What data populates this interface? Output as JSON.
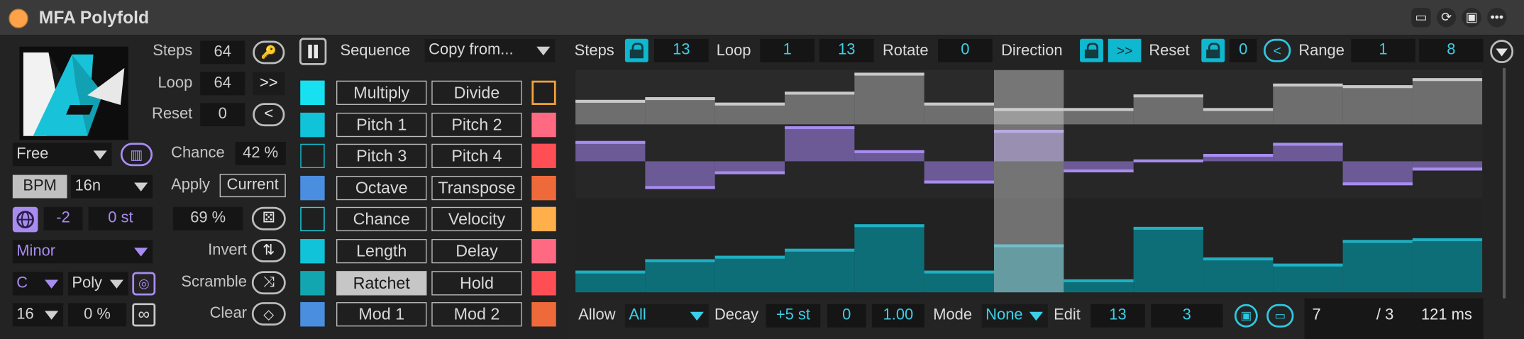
{
  "window": {
    "title": "MFA Polyfold"
  },
  "left": {
    "steps_label": "Steps",
    "steps_value": "64",
    "loop_label": "Loop",
    "loop_value": "64",
    "loop_btn": ">>",
    "reset_label": "Reset",
    "reset_value": "0",
    "reset_btn": "<",
    "mode_select": "Free",
    "bpm_label": "BPM",
    "rate_select": "16n",
    "transpose_value": "-2",
    "st_value": "0 st",
    "scale_select": "Minor",
    "root_select": "C",
    "poly_select": "Poly",
    "length_select": "16",
    "percent_value": "0 %",
    "chance_label": "Chance",
    "chance_value": "42 %",
    "apply_label": "Apply",
    "apply_value": "Current",
    "prob_value": "69 %",
    "invert_label": "Invert",
    "scramble_label": "Scramble",
    "clear_label": "Clear",
    "sequence_label": "Sequence",
    "copy_select": "Copy from..."
  },
  "mods": [
    {
      "left": "Multiply",
      "right": "Divide",
      "lcolor": "#17e0f0",
      "lhollow": false,
      "rcolor": "#f5a33a",
      "rhollow": true,
      "active": false
    },
    {
      "left": "Pitch 1",
      "right": "Pitch 2",
      "lcolor": "#10c3d8",
      "lhollow": false,
      "rcolor": "#ff6a82",
      "rhollow": false,
      "active": false
    },
    {
      "left": "Pitch 3",
      "right": "Pitch 4",
      "lcolor": "#10c3d8",
      "lhollow": true,
      "rcolor": "#ff4f55",
      "rhollow": false,
      "active": false
    },
    {
      "left": "Octave",
      "right": "Transpose",
      "lcolor": "#4a8ee0",
      "lhollow": false,
      "rcolor": "#ef6a3a",
      "rhollow": false,
      "active": false
    },
    {
      "left": "Chance",
      "right": "Velocity",
      "lcolor": "#17e0f0",
      "lhollow": true,
      "rcolor": "#ffb04a",
      "rhollow": false,
      "active": false
    },
    {
      "left": "Length",
      "right": "Delay",
      "lcolor": "#10c3d8",
      "lhollow": false,
      "rcolor": "#ff6a82",
      "rhollow": false,
      "active": false
    },
    {
      "left": "Ratchet",
      "right": "Hold",
      "lcolor": "#12a7b0",
      "lhollow": false,
      "rcolor": "#ff4f55",
      "rhollow": false,
      "active": true
    },
    {
      "left": "Mod 1",
      "right": "Mod 2",
      "lcolor": "#4a8ee0",
      "lhollow": false,
      "rcolor": "#ef6a3a",
      "rhollow": false,
      "active": false
    }
  ],
  "seq": {
    "steps_label": "Steps",
    "steps_value": "13",
    "loop_label": "Loop",
    "loop_start": "1",
    "loop_end": "13",
    "rotate_label": "Rotate",
    "rotate_value": "0",
    "direction_label": "Direction",
    "direction_value": ">>",
    "reset_label": "Reset",
    "reset_value": "0",
    "reset_btn": "<",
    "range_label": "Range",
    "range_min": "1",
    "range_max": "8"
  },
  "footer": {
    "allow_label": "Allow",
    "allow_value": "All",
    "decay_label": "Decay",
    "decay_value": "+5 st",
    "decay_a": "0",
    "decay_b": "1.00",
    "mode_label": "Mode",
    "mode_value": "None",
    "edit_label": "Edit",
    "edit_a": "13",
    "edit_b": "3",
    "status_step": "7",
    "status_div": "/ 3",
    "status_ms": "121 ms"
  },
  "lanes": {
    "steps": 13,
    "playhead_step": 6,
    "gray": [
      0.45,
      0.5,
      0.4,
      0.6,
      0.95,
      0.4,
      0.3,
      0.3,
      0.55,
      0.3,
      0.75,
      0.72,
      0.85
    ],
    "purple": [
      0.55,
      -0.75,
      -0.35,
      0.95,
      0.3,
      -0.6,
      0.85,
      -0.3,
      0.05,
      0.2,
      0.5,
      -0.65,
      -0.25
    ],
    "teal": [
      0.25,
      0.38,
      0.42,
      0.5,
      0.78,
      0.25,
      0.55,
      0.15,
      0.75,
      0.4,
      0.33,
      0.6,
      0.62
    ]
  }
}
